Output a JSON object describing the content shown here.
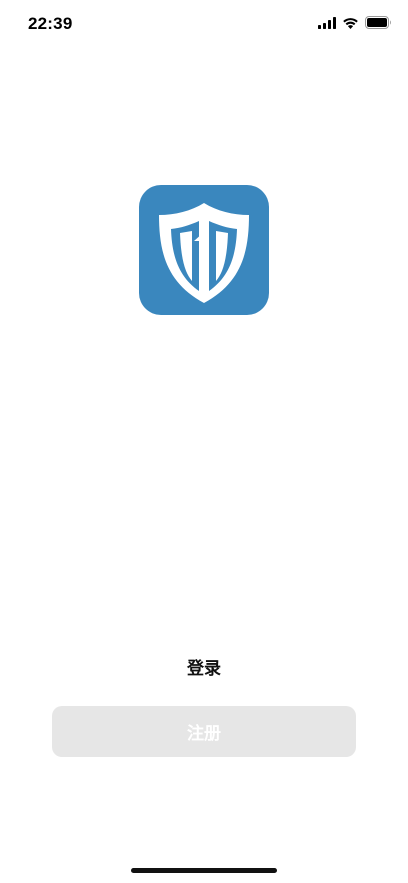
{
  "status_bar": {
    "time": "22:39",
    "icons": [
      "cellular-signal-icon",
      "wifi-icon",
      "battery-icon"
    ]
  },
  "logo": {
    "icon": "shield-logo-icon",
    "background_color": "#3a87be"
  },
  "actions": {
    "login_label": "登录",
    "register_label": "注册"
  },
  "colors": {
    "register_button_bg": "#e6e6e6",
    "register_button_text": "#ffffff"
  }
}
